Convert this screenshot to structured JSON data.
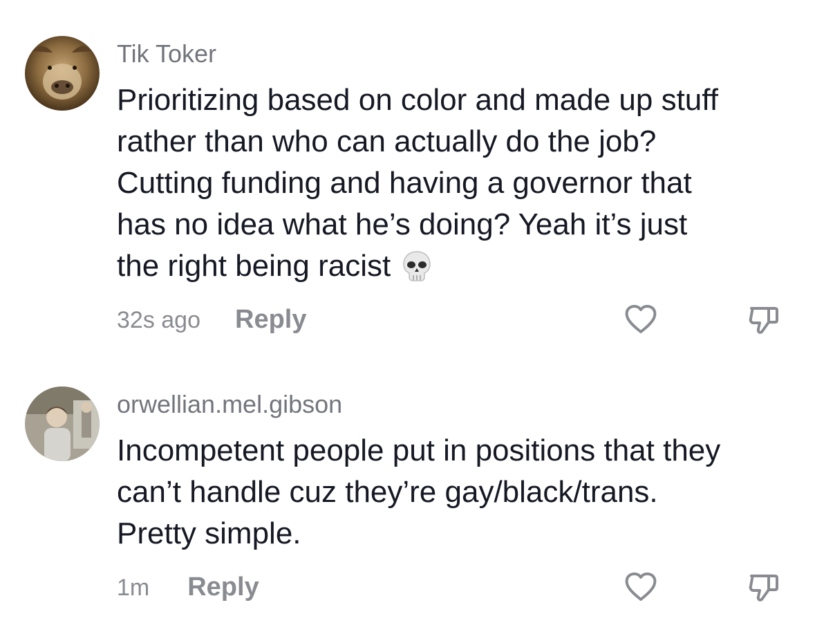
{
  "comments": [
    {
      "username": "Tik Toker",
      "lines": [
        "Prioritizing based on color and made up stuff",
        "rather than who can actually do the job?",
        "Cutting funding and having a governor that",
        "has no idea what he’s doing? Yeah it’s just",
        "the right being racist"
      ],
      "emoji": "skull-icon",
      "timestamp": "32s ago",
      "reply_label": "Reply",
      "avatar": "avatar-icon"
    },
    {
      "username": "orwellian.mel.gibson",
      "lines": [
        "Incompetent people put in positions that they",
        "can’t handle cuz they’re gay/black/trans.",
        "Pretty simple."
      ],
      "timestamp": "1m",
      "reply_label": "Reply",
      "avatar": "avatar-icon"
    }
  ],
  "colors": {
    "text_primary": "#161823",
    "text_secondary": "#73757c",
    "icon_gray": "#8a8b91",
    "background": "#ffffff"
  }
}
